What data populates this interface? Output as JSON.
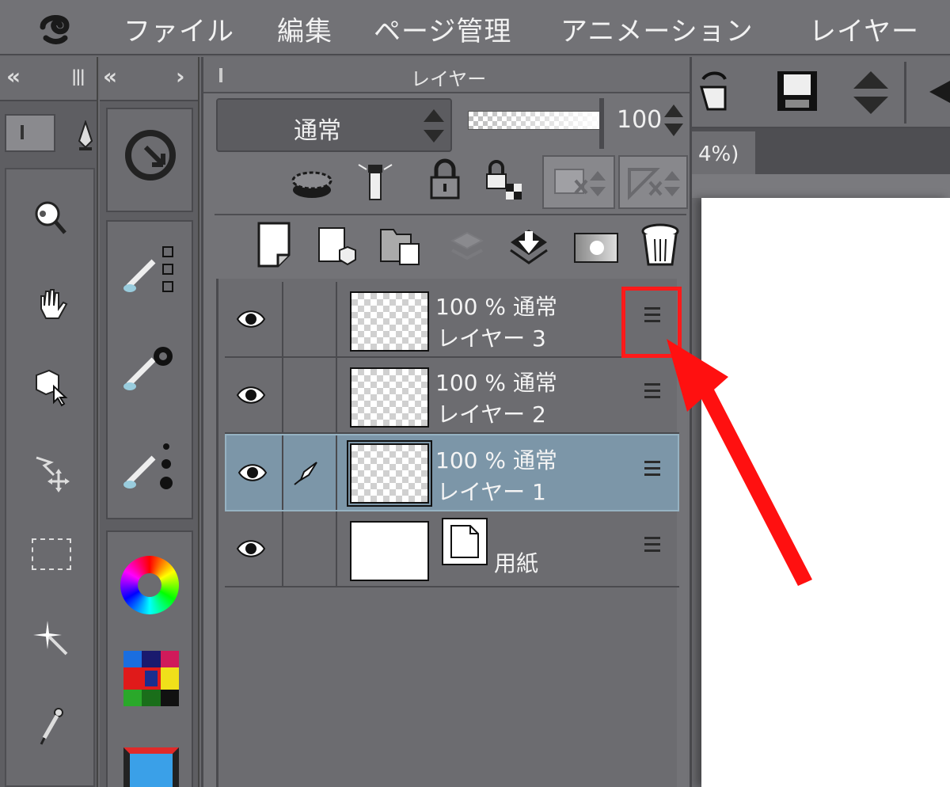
{
  "menu": {
    "items": [
      "ファイル",
      "編集",
      "ページ管理",
      "アニメーション",
      "レイヤー"
    ]
  },
  "layer_panel": {
    "title": "レイヤー",
    "blend_mode": "通常",
    "opacity": "100"
  },
  "layers": [
    {
      "opacity_mode": "100 % 通常",
      "name": "レイヤー 3",
      "selected": false,
      "thumbnail": "transparent"
    },
    {
      "opacity_mode": "100 % 通常",
      "name": "レイヤー 2",
      "selected": false,
      "thumbnail": "transparent"
    },
    {
      "opacity_mode": "100 % 通常",
      "name": "レイヤー 1",
      "selected": true,
      "thumbnail": "transparent"
    },
    {
      "opacity_mode": "",
      "name": "用紙",
      "selected": false,
      "thumbnail": "white"
    }
  ],
  "canvas_tab": {
    "zoom_label": "4%)"
  },
  "colors": {
    "highlight": "#ff1a1a",
    "selected_row": "#7c96a8",
    "panel_bg": "#737377"
  },
  "icons": [
    "clip-studio-logo-icon",
    "zoom-tool-icon",
    "hand-tool-icon",
    "object-tool-icon",
    "move-tool-icon",
    "selection-tool-icon",
    "auto-select-icon",
    "eyedropper-icon",
    "quick-access-icon",
    "color-wheel-icon",
    "color-set-icon",
    "film-icon",
    "eye-icon",
    "pen-icon",
    "layer-menu-icon"
  ]
}
